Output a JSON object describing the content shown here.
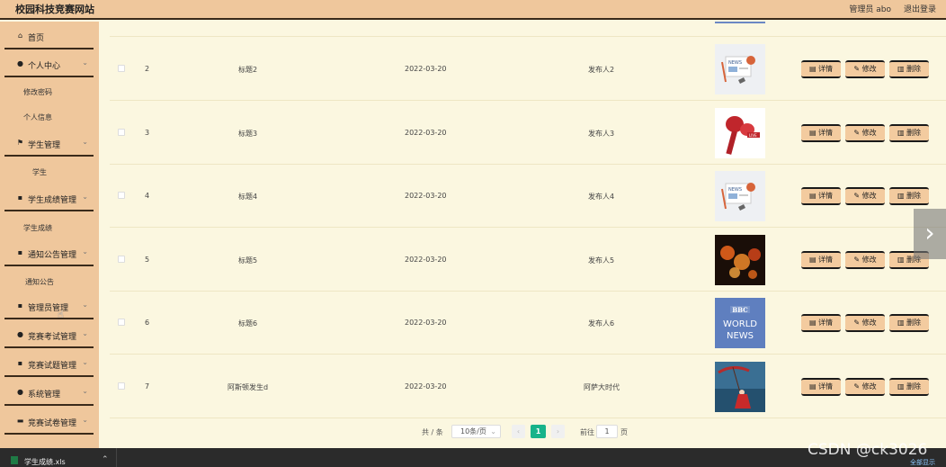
{
  "header": {
    "title": "校园科技竞赛网站",
    "user": "管理员 abo",
    "logout": "退出登录"
  },
  "sidebar": {
    "items": [
      {
        "label": "首页",
        "icon": "home-icon",
        "glyph": "⌂"
      },
      {
        "label": "个人中心",
        "icon": "user-icon",
        "glyph": "●",
        "chevron": true
      },
      {
        "label": "学生管理",
        "icon": "flag-icon",
        "glyph": "⚑",
        "chevron": true
      },
      {
        "label": "学生成绩管理",
        "icon": "grid-icon",
        "glyph": "▪",
        "chevron": true
      },
      {
        "label": "通知公告管理",
        "icon": "grid-icon",
        "glyph": "▪",
        "chevron": true
      },
      {
        "label": "管理员管理",
        "icon": "grid-icon",
        "glyph": "▪",
        "chevron": true
      },
      {
        "label": "竞赛考试管理",
        "icon": "bulb-icon",
        "glyph": "●",
        "chevron": true
      },
      {
        "label": "竞赛试题管理",
        "icon": "grid-icon",
        "glyph": "▪",
        "chevron": true
      },
      {
        "label": "系统管理",
        "icon": "user-icon",
        "glyph": "●",
        "chevron": true
      },
      {
        "label": "竞赛试卷管理",
        "icon": "briefcase-icon",
        "glyph": "▬",
        "chevron": true
      }
    ],
    "subitems": [
      "修改密码",
      "个人信息",
      "学生",
      "学生成绩",
      "通知公告"
    ]
  },
  "table": {
    "rows": [
      {
        "index": "2",
        "title": "标题2",
        "date": "2022-03-20",
        "publisher": "发布人2",
        "image": "news-illustration"
      },
      {
        "index": "3",
        "title": "标题3",
        "date": "2022-03-20",
        "publisher": "发布人3",
        "image": "microphone-live"
      },
      {
        "index": "4",
        "title": "标题4",
        "date": "2022-03-20",
        "publisher": "发布人4",
        "image": "news-illustration"
      },
      {
        "index": "5",
        "title": "标题5",
        "date": "2022-03-20",
        "publisher": "发布人5",
        "image": "fire-letters"
      },
      {
        "index": "6",
        "title": "标题6",
        "date": "2022-03-20",
        "publisher": "发布人6",
        "image": "bbc-world-news"
      },
      {
        "index": "7",
        "title": "阿斯顿发生d",
        "date": "2022-03-20",
        "publisher": "阿萨大时代",
        "image": "woman-umbrella"
      }
    ],
    "actions": {
      "detail": "详情",
      "edit": "修改",
      "delete": "删除"
    }
  },
  "thumb_text": {
    "news": "NEWS",
    "live": "LIVE",
    "bbc": "BBC",
    "world": "WORLD",
    "news2": "NEWS"
  },
  "pagination": {
    "total_label": "共 / 条",
    "page_size": "10条/页",
    "current_page": "1",
    "goto_label": "前往",
    "goto_value": "1",
    "page_suffix": "页"
  },
  "taskbar": {
    "file_name": "学生成绩.xls",
    "show_all": "全部显示"
  },
  "watermark": "CSDN @ck3026",
  "colors": {
    "sidebar": "#efc79c",
    "content": "#fbf7e0",
    "button": "#f3cb9f",
    "active_page": "#17b38a"
  }
}
